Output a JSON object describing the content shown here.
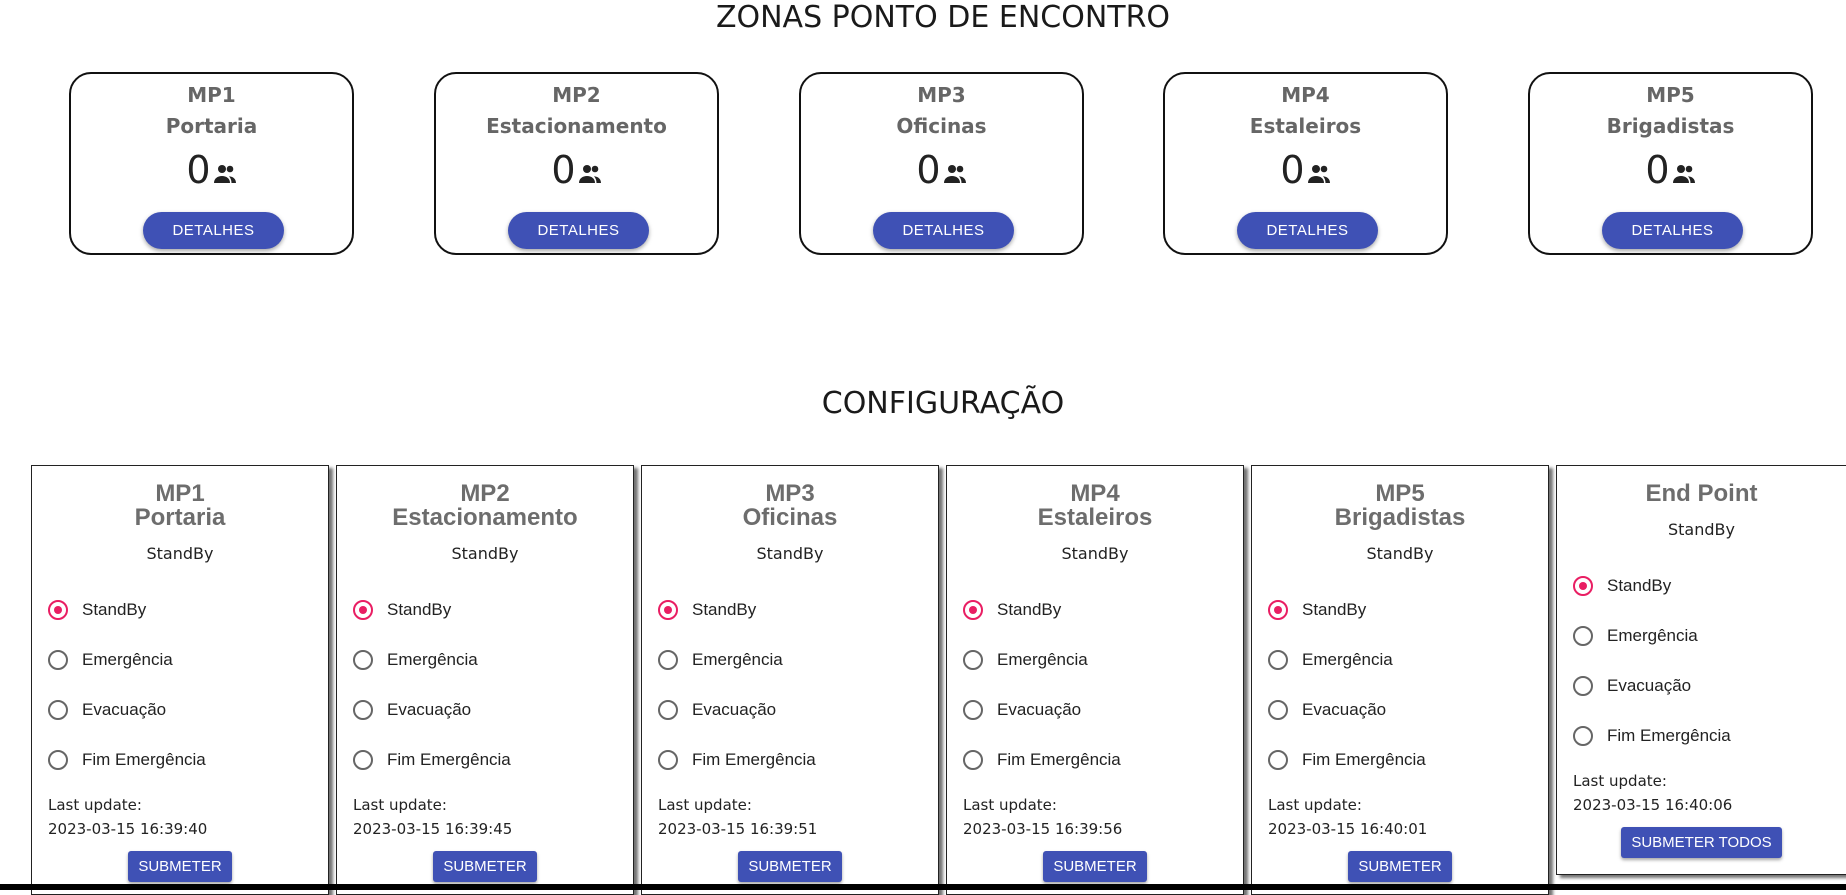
{
  "zonas_title": "ZONAS PONTO DE ENCONTRO",
  "config_title": "CONFIGURAÇÃO",
  "zones": [
    {
      "code": "MP1",
      "name": "Portaria",
      "count": "0",
      "button": "DETALHES"
    },
    {
      "code": "MP2",
      "name": "Estacionamento",
      "count": "0",
      "button": "DETALHES"
    },
    {
      "code": "MP3",
      "name": "Oficinas",
      "count": "0",
      "button": "DETALHES"
    },
    {
      "code": "MP4",
      "name": "Estaleiros",
      "count": "0",
      "button": "DETALHES"
    },
    {
      "code": "MP5",
      "name": "Brigadistas",
      "count": "0",
      "button": "DETALHES"
    }
  ],
  "options": [
    "StandBy",
    "Emergência",
    "Evacuação",
    "Fim Emergência"
  ],
  "last_update_label": "Last update:",
  "config": [
    {
      "code": "MP1",
      "name": "Portaria",
      "status": "StandBy",
      "selected": "StandBy",
      "last_update": "2023-03-15 16:39:40",
      "button": "SUBMETER"
    },
    {
      "code": "MP2",
      "name": "Estacionamento",
      "status": "StandBy",
      "selected": "StandBy",
      "last_update": "2023-03-15 16:39:45",
      "button": "SUBMETER"
    },
    {
      "code": "MP3",
      "name": "Oficinas",
      "status": "StandBy",
      "selected": "StandBy",
      "last_update": "2023-03-15 16:39:51",
      "button": "SUBMETER"
    },
    {
      "code": "MP4",
      "name": "Estaleiros",
      "status": "StandBy",
      "selected": "StandBy",
      "last_update": "2023-03-15 16:39:56",
      "button": "SUBMETER"
    },
    {
      "code": "MP5",
      "name": "Brigadistas",
      "status": "StandBy",
      "selected": "StandBy",
      "last_update": "2023-03-15 16:40:01",
      "button": "SUBMETER"
    }
  ],
  "endpoint": {
    "title": "End Point",
    "status": "StandBy",
    "selected": "StandBy",
    "last_update": "2023-03-15 16:40:06",
    "button": "SUBMETER TODOS"
  },
  "colors": {
    "primary": "#3f51b5",
    "radio_accent": "#e91e63",
    "title_gray": "#666666"
  },
  "icons": {
    "people": "people-icon"
  }
}
